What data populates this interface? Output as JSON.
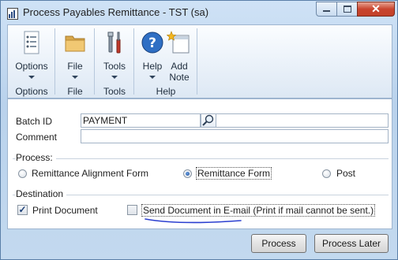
{
  "window": {
    "title": "Process Payables Remittance  -  TST (sa)"
  },
  "caption_buttons": {
    "minimize": "–",
    "maximize": "□",
    "close": "✕"
  },
  "ribbon": {
    "groups": [
      {
        "label": "Options",
        "buttons": [
          {
            "label": "Options",
            "icon": "options-list-icon",
            "has_dropdown": true
          }
        ]
      },
      {
        "label": "File",
        "buttons": [
          {
            "label": "File",
            "icon": "folder-icon",
            "has_dropdown": true
          }
        ]
      },
      {
        "label": "Tools",
        "buttons": [
          {
            "label": "Tools",
            "icon": "tools-icon",
            "has_dropdown": true
          }
        ]
      },
      {
        "label": "Help",
        "buttons": [
          {
            "label": "Help",
            "icon": "help-icon",
            "has_dropdown": true
          },
          {
            "label": "Add\nNote",
            "label_line1": "Add",
            "label_line2": "Note",
            "icon": "add-note-icon",
            "has_dropdown": false
          }
        ]
      }
    ]
  },
  "form": {
    "batch_id": {
      "label": "Batch ID",
      "value": "PAYMENT"
    },
    "comment": {
      "label": "Comment",
      "value": ""
    },
    "process": {
      "title": "Process:",
      "options": [
        {
          "label": "Remittance Alignment Form",
          "selected": false
        },
        {
          "label": "Remittance Form",
          "selected": true
        },
        {
          "label": "Post",
          "selected": false
        }
      ]
    },
    "destination": {
      "title": "Destination",
      "options": [
        {
          "label": "Print Document",
          "checked": true
        },
        {
          "label": "Send Document in E-mail (Print if mail cannot be sent.)",
          "checked": false
        }
      ]
    }
  },
  "buttons": {
    "process": "Process",
    "process_later": "Process Later"
  },
  "colors": {
    "annotation_underline": "#2b3fd0",
    "window_frame": "#c6dcf2",
    "close_button": "#c9452e"
  }
}
